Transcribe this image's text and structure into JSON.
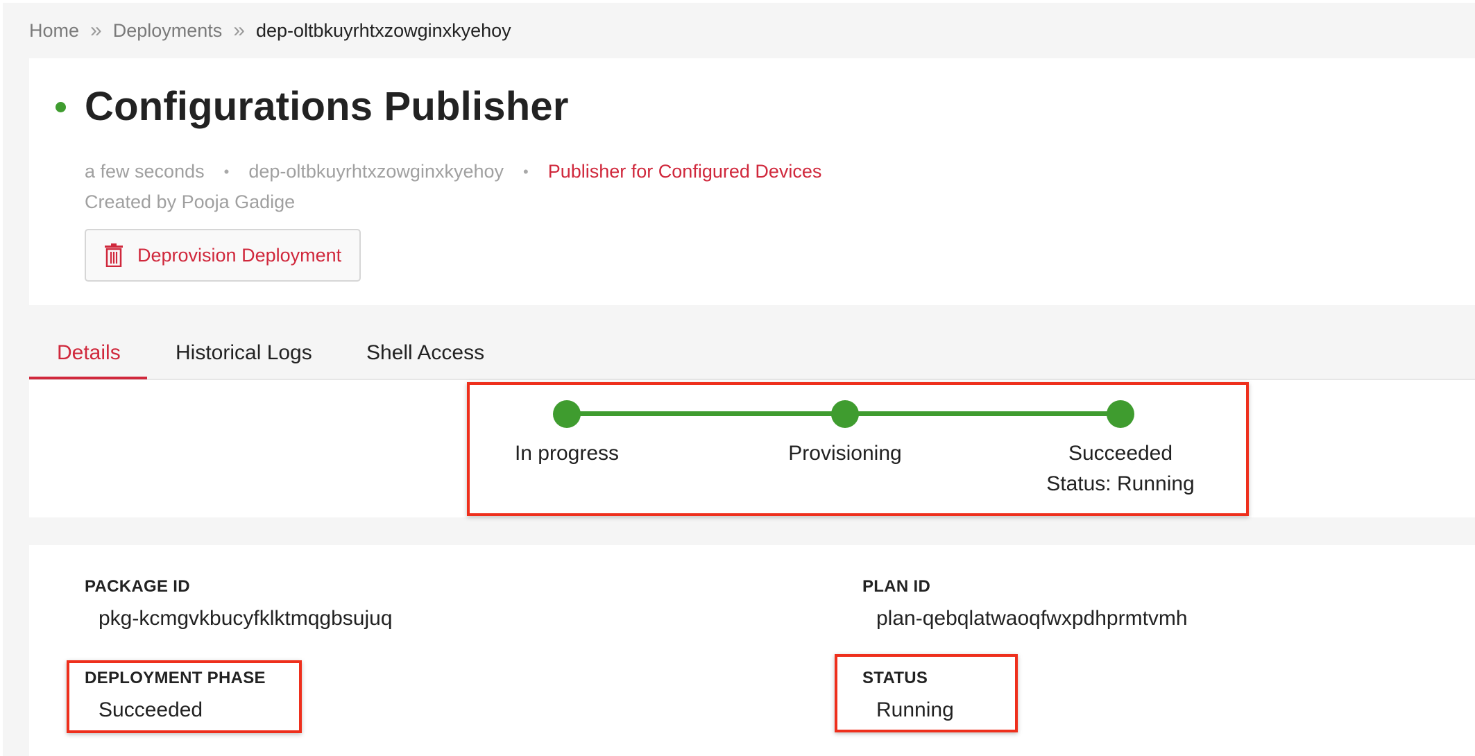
{
  "breadcrumb": {
    "items": [
      "Home",
      "Deployments"
    ],
    "separator": "»",
    "current": "dep-oltbkuyrhtxzowginxkyehoy"
  },
  "header": {
    "title": "Configurations Publisher",
    "status_color": "#3f9c2f",
    "meta": {
      "time": "a few seconds",
      "deployment_id": "dep-oltbkuyrhtxzowginxkyehoy",
      "description": "Publisher for Configured Devices",
      "separator": "•"
    },
    "created_by": "Created by Pooja Gadige",
    "deprovision_label": "Deprovision Deployment"
  },
  "tabs": [
    {
      "label": "Details",
      "active": true
    },
    {
      "label": "Historical Logs",
      "active": false
    },
    {
      "label": "Shell Access",
      "active": false
    }
  ],
  "progress": {
    "steps": [
      "In progress",
      "Provisioning",
      "Succeeded"
    ],
    "final_status": "Status: Running",
    "color": "#3f9c2f"
  },
  "details": {
    "package_id_label": "PACKAGE ID",
    "package_id": "pkg-kcmgvkbucyfklktmqgbsujuq",
    "plan_id_label": "PLAN ID",
    "plan_id": "plan-qebqlatwaoqfwxpdhprmtvmh",
    "deployment_phase_label": "DEPLOYMENT PHASE",
    "deployment_phase": "Succeeded",
    "status_label": "STATUS",
    "status": "Running"
  },
  "colors": {
    "accent": "#d0283c",
    "success": "#3f9c2f",
    "annotation": "#ee2f1c"
  }
}
